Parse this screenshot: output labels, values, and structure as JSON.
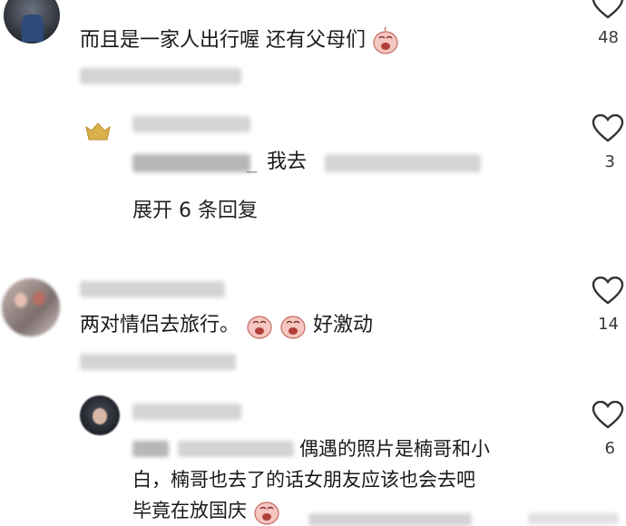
{
  "comments": [
    {
      "text": "而且是一家人出行喔 还有父母们",
      "likes": "48"
    },
    {
      "text": "两对情侣去旅行。",
      "text_after": "好激动",
      "likes": "14"
    }
  ],
  "replies": [
    {
      "prefix": "_",
      "text": "我去",
      "likes": "3"
    },
    {
      "text_line1": "偶遇的照片是楠哥和小",
      "text_line2": "白，楠哥也去了的话女朋友应该也会去吧",
      "text_line3": "毕竟在放国庆",
      "likes": "6"
    }
  ],
  "expand_label": "展开 6 条回复",
  "icons": {
    "like": "heart-outline-icon",
    "emoji": "crying-face-emoji"
  }
}
